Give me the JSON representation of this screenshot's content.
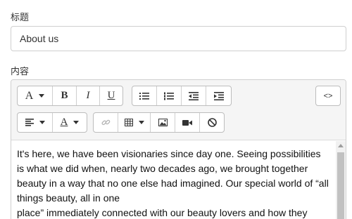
{
  "title_field": {
    "label": "标题",
    "value": "About us"
  },
  "content_field": {
    "label": "内容"
  },
  "toolbar": {
    "font_glyph": "A",
    "bold_glyph": "B",
    "italic_glyph": "I",
    "underline_glyph": "U",
    "code_view_glyph": "<>",
    "font_color_glyph": "A"
  },
  "body_paragraphs": [
    "It's here, we have been visionaries since day one. Seeing possibilities is what we did when, nearly two decades ago, we brought together beauty in a way that no one else had imagined. Our special world of “all things beauty, all in one",
    "place” immediately connected with our beauty lovers and how they"
  ]
}
